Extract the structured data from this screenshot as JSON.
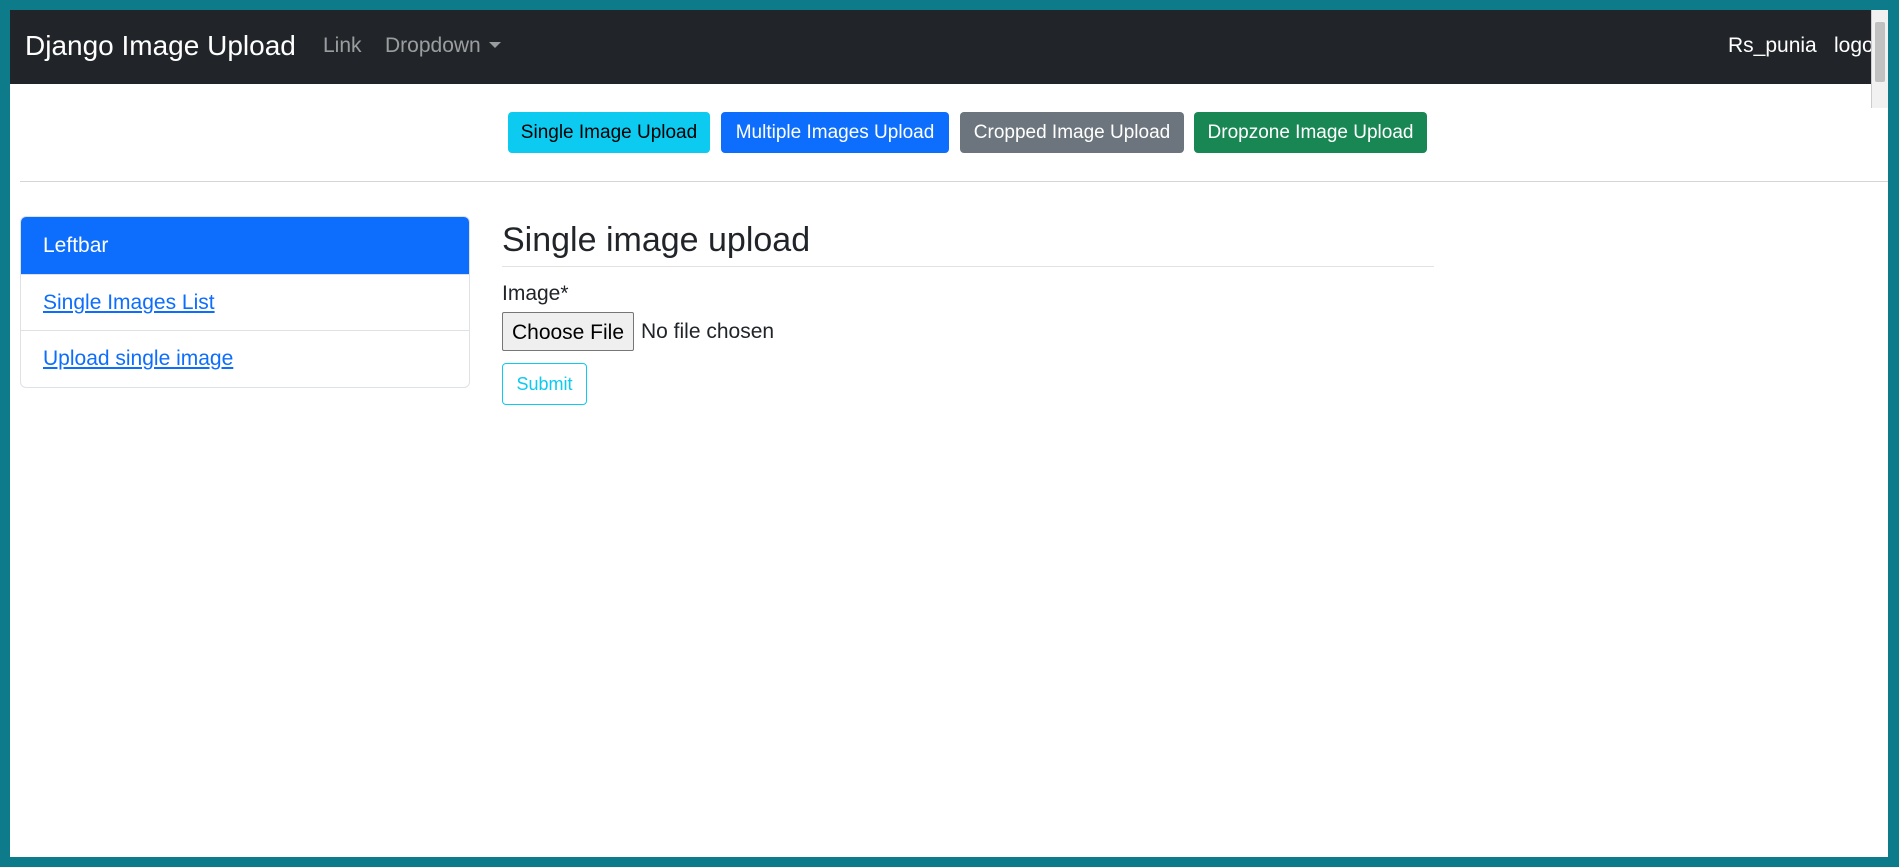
{
  "navbar": {
    "brand": "Django Image Upload",
    "link": "Link",
    "dropdown": "Dropdown",
    "user": "Rs_punia",
    "logout": "logou"
  },
  "top_buttons": {
    "single": "Single Image Upload",
    "multiple": "Multiple Images Upload",
    "cropped": "Cropped Image Upload",
    "dropzone": "Dropzone Image Upload"
  },
  "leftbar": {
    "header": "Leftbar",
    "items": [
      {
        "label": "Single Images List"
      },
      {
        "label": "Upload single image"
      }
    ]
  },
  "main": {
    "title": "Single image upload",
    "field_label": "Image*",
    "file_button": "Choose File",
    "file_status": "No file chosen",
    "submit": "Submit"
  },
  "colors": {
    "navbar": "#212529",
    "info": "#0dcaf0",
    "primary": "#0d6efd",
    "secondary": "#6c757d",
    "success": "#198754",
    "frame": "#0e7b8a"
  }
}
